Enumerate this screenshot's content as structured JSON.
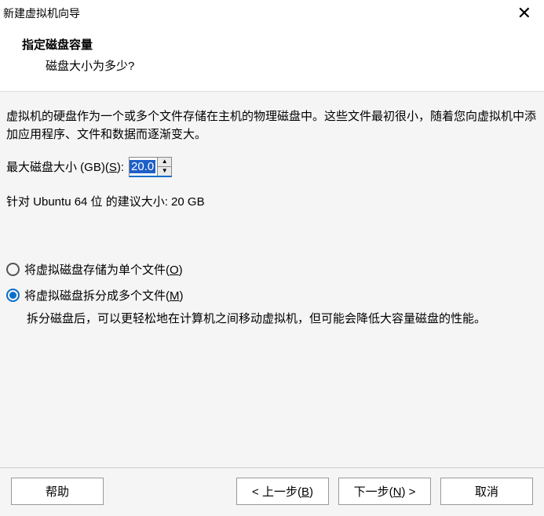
{
  "titlebar": {
    "title": "新建虚拟机向导"
  },
  "header": {
    "heading": "指定磁盘容量",
    "sub": "磁盘大小为多少?"
  },
  "content": {
    "desc": "虚拟机的硬盘作为一个或多个文件存储在主机的物理磁盘中。这些文件最初很小，随着您向虚拟机中添加应用程序、文件和数据而逐渐变大。",
    "size_label_pre": "最大磁盘大小 (GB)(",
    "size_label_key": "S",
    "size_label_post": "):",
    "size_value": "20.0",
    "recommend": "针对 Ubuntu 64 位 的建议大小: 20 GB",
    "radio1_pre": "将虚拟磁盘存储为单个文件(",
    "radio1_key": "O",
    "radio1_post": ")",
    "radio2_pre": "将虚拟磁盘拆分成多个文件(",
    "radio2_key": "M",
    "radio2_post": ")",
    "radio2_help": "拆分磁盘后，可以更轻松地在计算机之间移动虚拟机，但可能会降低大容量磁盘的性能。"
  },
  "footer": {
    "help": "帮助",
    "back_pre": "< 上一步(",
    "back_key": "B",
    "back_post": ")",
    "next_pre": "下一步(",
    "next_key": "N",
    "next_post": ") >",
    "cancel": "取消"
  }
}
